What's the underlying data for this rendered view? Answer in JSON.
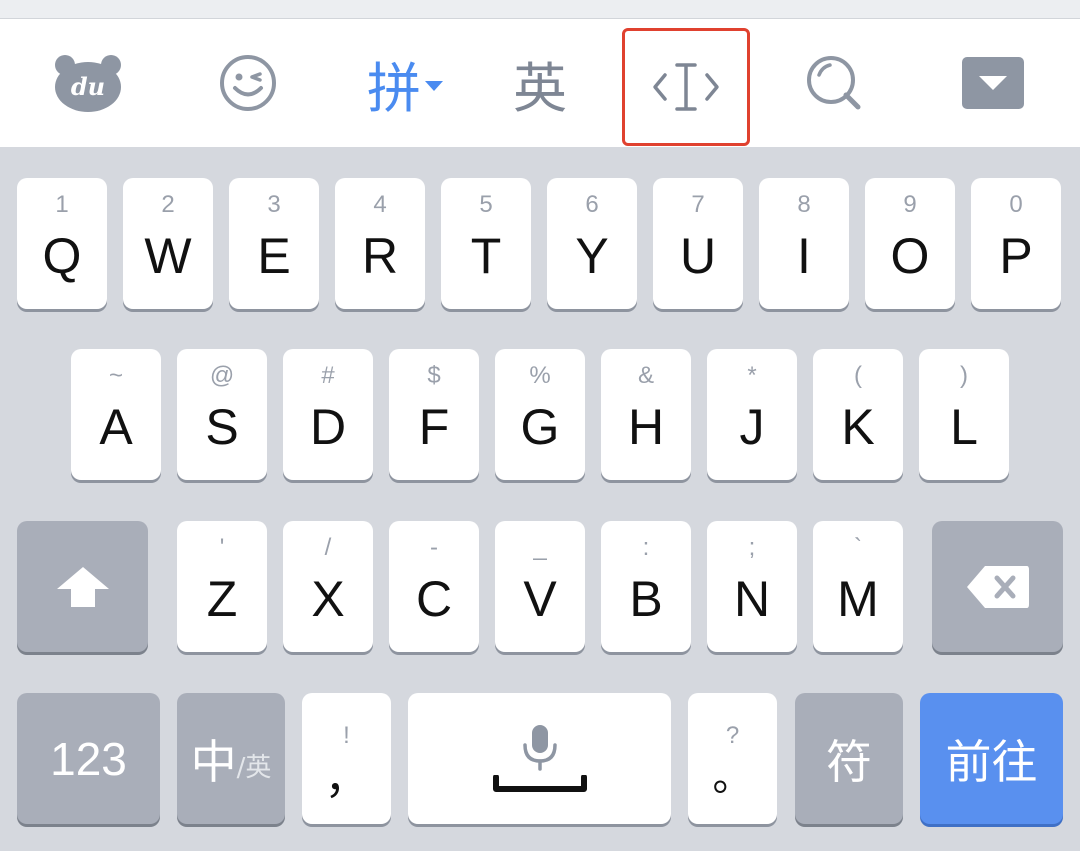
{
  "toolbar": {
    "pinyin_label": "拼",
    "english_label": "英",
    "du_logo_text": "du",
    "icons": [
      "du-logo-icon",
      "emoji-icon",
      "cursor-move-icon",
      "search-icon",
      "hide-keyboard-icon"
    ]
  },
  "rows": {
    "row1": [
      {
        "hint": "1",
        "label": "Q"
      },
      {
        "hint": "2",
        "label": "W"
      },
      {
        "hint": "3",
        "label": "E"
      },
      {
        "hint": "4",
        "label": "R"
      },
      {
        "hint": "5",
        "label": "T"
      },
      {
        "hint": "6",
        "label": "Y"
      },
      {
        "hint": "7",
        "label": "U"
      },
      {
        "hint": "8",
        "label": "I"
      },
      {
        "hint": "9",
        "label": "O"
      },
      {
        "hint": "0",
        "label": "P"
      }
    ],
    "row2": [
      {
        "hint": "~",
        "label": "A"
      },
      {
        "hint": "@",
        "label": "S"
      },
      {
        "hint": "#",
        "label": "D"
      },
      {
        "hint": "$",
        "label": "F"
      },
      {
        "hint": "%",
        "label": "G"
      },
      {
        "hint": "&",
        "label": "H"
      },
      {
        "hint": "*",
        "label": "J"
      },
      {
        "hint": "(",
        "label": "K"
      },
      {
        "hint": ")",
        "label": "L"
      }
    ],
    "row3": [
      {
        "hint": "'",
        "label": "Z"
      },
      {
        "hint": "/",
        "label": "X"
      },
      {
        "hint": "-",
        "label": "C"
      },
      {
        "hint": "_",
        "label": "V"
      },
      {
        "hint": ":",
        "label": "B"
      },
      {
        "hint": ";",
        "label": "N"
      },
      {
        "hint": "`",
        "label": "M"
      }
    ]
  },
  "bottom": {
    "num_label": "123",
    "lang_main": "中",
    "lang_sub": "/英",
    "comma_hint": "!",
    "comma_label": "，",
    "period_hint": "?",
    "period_label": "。",
    "symbol_label": "符",
    "go_label": "前往"
  },
  "colors": {
    "accent": "#4a8bf0",
    "go_key": "#5990ef",
    "function_key": "#a9aeb9",
    "highlight_border": "#e0412f"
  }
}
